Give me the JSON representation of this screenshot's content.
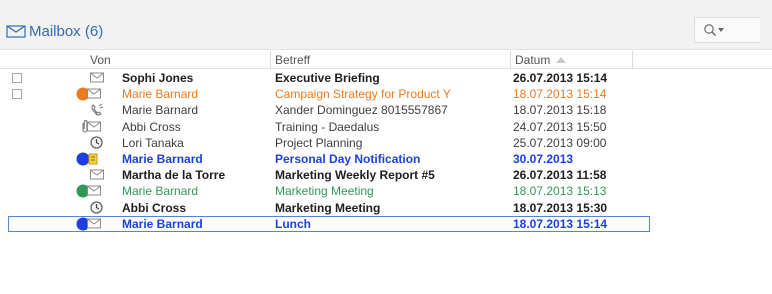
{
  "mailbox": {
    "title": "Mailbox (6)"
  },
  "columns": {
    "from": "Von",
    "subject": "Betreff",
    "date": "Datum"
  },
  "colors": {
    "orange": "#ee7a1e",
    "blue": "#1b3fe0",
    "green": "#2f9a55",
    "accent": "#2f6db5"
  },
  "emails": [
    {
      "from": "Sophi Jones",
      "subject": "Executive Briefing",
      "date": "26.07.2013 15:14",
      "style": "bold",
      "checkbox": true,
      "icons": [
        "envelope-icon"
      ]
    },
    {
      "from": "Marie Barnard",
      "subject": "Campaign Strategy for Product Y",
      "date": "18.07.2013 15:14",
      "style": "orange",
      "checkbox": true,
      "icons": [
        "orange-category-icon",
        "envelope-icon"
      ]
    },
    {
      "from": "Marie Barnard",
      "subject": "Xander Dominguez 8015557867",
      "date": "18.07.2013 15:18",
      "style": "normal",
      "checkbox": false,
      "icons": [
        "phone-icon"
      ]
    },
    {
      "from": "Abbi Cross",
      "subject": "Training - Daedalus",
      "date": "24.07.2013 15:50",
      "style": "normal",
      "checkbox": false,
      "icons": [
        "attachment-icon",
        "envelope-icon"
      ]
    },
    {
      "from": "Lori Tanaka",
      "subject": "Project Planning",
      "date": "25.07.2013 09:00",
      "style": "normal",
      "checkbox": false,
      "icons": [
        "clock-icon"
      ]
    },
    {
      "from": "Marie Barnard",
      "subject": "Personal Day Notification",
      "date": "30.07.2013",
      "style": "blue",
      "checkbox": false,
      "icons": [
        "blue-category-icon",
        "note-icon"
      ]
    },
    {
      "from": "Martha de la Torre",
      "subject": "Marketing Weekly Report #5",
      "date": "26.07.2013 11:58",
      "style": "bold",
      "checkbox": false,
      "icons": [
        "envelope-icon"
      ]
    },
    {
      "from": "Marie Barnard",
      "subject": "Marketing Meeting",
      "date": "18.07.2013 15:13",
      "style": "green",
      "checkbox": false,
      "icons": [
        "green-category-icon",
        "envelope-icon"
      ]
    },
    {
      "from": "Abbi Cross",
      "subject": "Marketing Meeting",
      "date": "18.07.2013 15:30",
      "style": "bold",
      "checkbox": false,
      "icons": [
        "clock-icon"
      ]
    },
    {
      "from": "Marie Barnard",
      "subject": "Lunch",
      "date": "18.07.2013 15:14",
      "style": "blue",
      "checkbox": false,
      "selected": true,
      "icons": [
        "blue-category-icon",
        "envelope-icon"
      ]
    }
  ]
}
